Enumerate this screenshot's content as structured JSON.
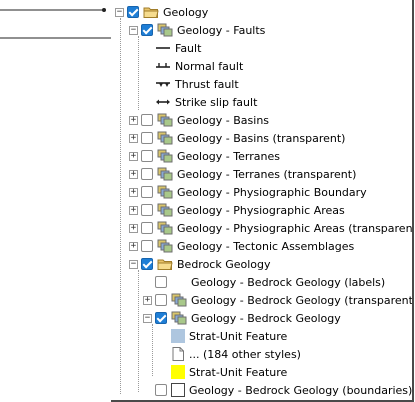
{
  "tree": {
    "root_label": "Geology",
    "faults": {
      "label": "Geology - Faults",
      "legend": [
        "Fault",
        "Normal fault",
        "Thrust fault",
        "Strike slip fault"
      ]
    },
    "layers": [
      "Geology - Basins",
      "Geology - Basins (transparent)",
      "Geology - Terranes",
      "Geology - Terranes (transparent)",
      "Geology - Physiographic Boundary",
      "Geology - Physiographic Areas",
      "Geology - Physiographic Areas (transparent)",
      "Geology - Tectonic Assemblages"
    ],
    "bedrock": {
      "label": "Bedrock Geology",
      "labels_layer": "Geology - Bedrock Geology (labels)",
      "transparent_layer": "Geology - Bedrock Geology (transparent)",
      "main_layer": "Geology - Bedrock Geology",
      "styles": [
        "Strat-Unit Feature",
        "... (184 other styles)",
        "Strat-Unit Feature"
      ],
      "boundaries_layer": "Geology - Bedrock Geology (boundaries)"
    }
  },
  "colors": {
    "check_blue": "#1e7ed6",
    "swatch_blue": "#aec6df",
    "swatch_yellow": "#ffff00"
  },
  "icons": {
    "group": "folder-icon",
    "layer": "layer-stack-icon",
    "expand": "plus-icon",
    "collapse": "minus-icon"
  }
}
